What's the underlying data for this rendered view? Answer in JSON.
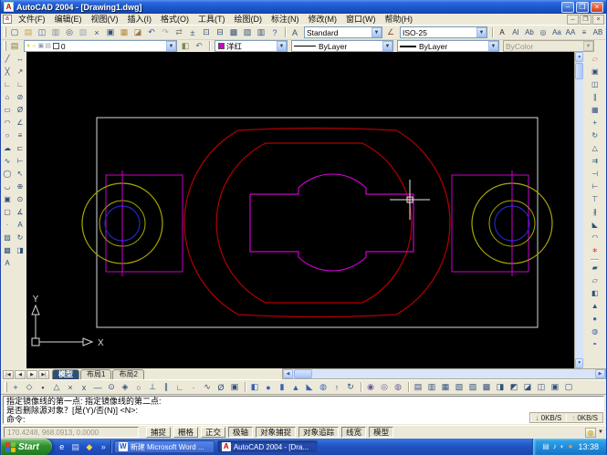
{
  "window": {
    "title": "AutoCAD 2004 - [Drawing1.dwg]"
  },
  "menu_bar": {
    "items": [
      {
        "name": "menu-file",
        "label": "文件(F)"
      },
      {
        "name": "menu-edit",
        "label": "编辑(E)"
      },
      {
        "name": "menu-view",
        "label": "视图(V)"
      },
      {
        "name": "menu-insert",
        "label": "插入(I)"
      },
      {
        "name": "menu-format",
        "label": "格式(O)"
      },
      {
        "name": "menu-tools",
        "label": "工具(T)"
      },
      {
        "name": "menu-draw",
        "label": "绘图(D)"
      },
      {
        "name": "menu-dimension",
        "label": "标注(N)"
      },
      {
        "name": "menu-modify",
        "label": "修改(M)"
      },
      {
        "name": "menu-window",
        "label": "窗口(W)"
      },
      {
        "name": "menu-help",
        "label": "帮助(H)"
      }
    ]
  },
  "standard_toolbar": [
    {
      "name": "new-file-icon",
      "glyph": "▢"
    },
    {
      "name": "open-file-icon",
      "glyph": "▤",
      "c": "#c8a24a"
    },
    {
      "name": "save-icon",
      "glyph": "◫",
      "c": "#3a62b8"
    },
    {
      "name": "plot-icon",
      "glyph": "▥",
      "c": "#7e8aa0"
    },
    {
      "name": "plot-preview-icon",
      "glyph": "◎"
    },
    {
      "name": "publish-icon",
      "glyph": "▧",
      "c": "#9aa6bc"
    },
    {
      "name": "cut-icon",
      "glyph": "×"
    },
    {
      "name": "copy-icon",
      "glyph": "▣"
    },
    {
      "name": "paste-icon",
      "glyph": "▦",
      "c": "#b08a3e"
    },
    {
      "name": "match-properties-icon",
      "glyph": "◪",
      "c": "#9a7a4e"
    },
    {
      "name": "undo-icon",
      "glyph": "↶",
      "c": "#2b58c8"
    },
    {
      "name": "redo-icon",
      "glyph": "↷",
      "c": "#9aa8c4"
    },
    {
      "name": "pan-icon",
      "glyph": "⇄",
      "c": "#8a8a8a"
    },
    {
      "name": "zoom-realtime-icon",
      "glyph": "±"
    },
    {
      "name": "zoom-window-icon",
      "glyph": "⊡"
    },
    {
      "name": "zoom-previous-icon",
      "glyph": "⊟"
    },
    {
      "name": "properties-icon",
      "glyph": "▩"
    },
    {
      "name": "designcenter-icon",
      "glyph": "▨"
    },
    {
      "name": "tool-palettes-icon",
      "glyph": "▥"
    },
    {
      "name": "help-icon",
      "glyph": "?",
      "c": "#2b58c8"
    }
  ],
  "styles_toolbar": {
    "text_style_icon": {
      "name": "text-style-icon",
      "glyph": "A"
    },
    "text_style_value": "Standard",
    "dim_style_icon": {
      "name": "dim-style-icon",
      "glyph": "∠",
      "c": "#8a4a2a"
    },
    "dim_style_value": "ISO-25"
  },
  "text_toolbar": [
    {
      "name": "mtext-icon",
      "glyph": "A",
      "c": "#202020"
    },
    {
      "name": "single-line-text-icon",
      "glyph": "AI"
    },
    {
      "name": "edit-text-icon",
      "glyph": "Ab"
    },
    {
      "name": "find-replace-icon",
      "glyph": "◎"
    },
    {
      "name": "text-style-manager-icon",
      "glyph": "Aa"
    },
    {
      "name": "scale-text-icon",
      "glyph": "AA"
    },
    {
      "name": "justify-text-icon",
      "glyph": "≡"
    },
    {
      "name": "convert-distance-icon",
      "glyph": "AB"
    }
  ],
  "layers_toolbar": {
    "manager_icon": {
      "name": "layer-properties-manager-icon",
      "glyph": "▤",
      "c": "#8a7a3e"
    },
    "bulb_icon": {
      "name": "layer-on-icon",
      "glyph": "●",
      "c": "#e8d44a"
    },
    "freeze_icon": {
      "name": "layer-freeze-icon",
      "glyph": "☼",
      "c": "#e8c81e"
    },
    "lock_icon": {
      "name": "layer-lock-icon",
      "glyph": "▣",
      "c": "#8a96b4"
    },
    "plot_icon": {
      "name": "layer-plot-icon",
      "glyph": "▤",
      "c": "#9a9a9a"
    },
    "current_layer": "0",
    "swatch_color": "#ffffff",
    "make_current_icon": {
      "name": "make-objects-layer-current-icon",
      "glyph": "◧",
      "c": "#7a8a5a"
    },
    "previous_icon": {
      "name": "layer-previous-icon",
      "glyph": "↶",
      "c": "#5a7a9e"
    }
  },
  "properties_toolbar": {
    "color_value": "洋红",
    "color_swatch": "#cc00cc",
    "linetype_value": "ByLayer",
    "lineweight_value": "ByLayer",
    "plot_style_value": "ByColor"
  },
  "draw_toolbar": [
    {
      "name": "line-icon",
      "glyph": "╱"
    },
    {
      "name": "construction-line-icon",
      "glyph": "╳"
    },
    {
      "name": "polyline-icon",
      "glyph": "∟"
    },
    {
      "name": "polygon-icon",
      "glyph": "⌂"
    },
    {
      "name": "rectangle-icon",
      "glyph": "▭"
    },
    {
      "name": "arc-icon",
      "glyph": "◠"
    },
    {
      "name": "circle-icon",
      "glyph": "○"
    },
    {
      "name": "revision-cloud-icon",
      "glyph": "☁"
    },
    {
      "name": "spline-icon",
      "glyph": "∿"
    },
    {
      "name": "ellipse-icon",
      "glyph": "◯"
    },
    {
      "name": "ellipse-arc-icon",
      "glyph": "◡"
    },
    {
      "name": "insert-block-icon",
      "glyph": "▣"
    },
    {
      "name": "make-block-icon",
      "glyph": "▢"
    },
    {
      "name": "point-icon",
      "glyph": "·"
    },
    {
      "name": "hatch-icon",
      "glyph": "▨"
    },
    {
      "name": "region-icon",
      "glyph": "▩"
    },
    {
      "name": "multiline-text-icon",
      "glyph": "A"
    }
  ],
  "dimension_toolbar": [
    {
      "name": "linear-dimension-icon",
      "glyph": "↔"
    },
    {
      "name": "aligned-dimension-icon",
      "glyph": "↗"
    },
    {
      "name": "ordinate-dimension-icon",
      "glyph": "∟"
    },
    {
      "name": "radius-dimension-icon",
      "glyph": "⊘"
    },
    {
      "name": "diameter-dimension-icon",
      "glyph": "Ø"
    },
    {
      "name": "angular-dimension-icon",
      "glyph": "∠"
    },
    {
      "name": "quick-dimension-icon",
      "glyph": "≡"
    },
    {
      "name": "baseline-dimension-icon",
      "glyph": "⊏"
    },
    {
      "name": "continue-dimension-icon",
      "glyph": "⊢"
    },
    {
      "name": "quick-leader-icon",
      "glyph": "↖"
    },
    {
      "name": "tolerance-icon",
      "glyph": "⊕"
    },
    {
      "name": "center-mark-icon",
      "glyph": "⊙"
    },
    {
      "name": "dimension-edit-icon",
      "glyph": "∡"
    },
    {
      "name": "dimension-text-edit-icon",
      "glyph": "A"
    },
    {
      "name": "dimension-update-icon",
      "glyph": "↻"
    },
    {
      "name": "dimension-style-icon",
      "glyph": "◨"
    }
  ],
  "modify_toolbar": [
    {
      "name": "erase-icon",
      "glyph": "▱",
      "c": "#c87a7a"
    },
    {
      "name": "copy-object-icon",
      "glyph": "▣"
    },
    {
      "name": "mirror-icon",
      "glyph": "◫"
    },
    {
      "name": "offset-icon",
      "glyph": "∥"
    },
    {
      "name": "array-icon",
      "glyph": "▦"
    },
    {
      "name": "move-icon",
      "glyph": "+"
    },
    {
      "name": "rotate-icon",
      "glyph": "↻"
    },
    {
      "name": "scale-icon",
      "glyph": "△"
    },
    {
      "name": "stretch-icon",
      "glyph": "⇉"
    },
    {
      "name": "trim-icon",
      "glyph": "⊣"
    },
    {
      "name": "extend-icon",
      "glyph": "⊢"
    },
    {
      "name": "break-at-point-icon",
      "glyph": "⊤"
    },
    {
      "name": "break-icon",
      "glyph": "∦"
    },
    {
      "name": "chamfer-icon",
      "glyph": "◣"
    },
    {
      "name": "fillet-icon",
      "glyph": "◠"
    },
    {
      "name": "explode-icon",
      "glyph": "∗",
      "c": "#c8503c"
    }
  ],
  "surfaces_toolbar": [
    {
      "name": "surface-2dsolid-icon",
      "glyph": "▰"
    },
    {
      "name": "surface-3dface-icon",
      "glyph": "▱"
    },
    {
      "name": "surface-box-icon",
      "glyph": "◧"
    },
    {
      "name": "surface-pyramid-icon",
      "glyph": "▲"
    },
    {
      "name": "render-sphere-icon",
      "glyph": "●",
      "c": "#3a62b8"
    },
    {
      "name": "render-torus-icon",
      "glyph": "◍",
      "c": "#3a62b8"
    },
    {
      "name": "render-dome-icon",
      "glyph": "◓",
      "c": "#3a62b8"
    }
  ],
  "osnap_toolbar": [
    {
      "name": "temporary-track-point-icon",
      "glyph": "+"
    },
    {
      "name": "snap-from-icon",
      "glyph": "◇"
    },
    {
      "name": "snap-endpoint-icon",
      "glyph": "▪"
    },
    {
      "name": "snap-midpoint-icon",
      "glyph": "△"
    },
    {
      "name": "snap-intersection-icon",
      "glyph": "×"
    },
    {
      "name": "snap-apparent-intersection-icon",
      "glyph": "x"
    },
    {
      "name": "snap-extension-icon",
      "glyph": "—"
    },
    {
      "name": "snap-center-icon",
      "glyph": "⊙"
    },
    {
      "name": "snap-quadrant-icon",
      "glyph": "◈"
    },
    {
      "name": "snap-tangent-icon",
      "glyph": "○"
    },
    {
      "name": "snap-perpendicular-icon",
      "glyph": "⊥"
    },
    {
      "name": "snap-parallel-icon",
      "glyph": "∥"
    },
    {
      "name": "snap-insert-icon",
      "glyph": "∟"
    },
    {
      "name": "snap-node-icon",
      "glyph": "·"
    },
    {
      "name": "snap-nearest-icon",
      "glyph": "∿"
    },
    {
      "name": "snap-none-icon",
      "glyph": "Ø"
    },
    {
      "name": "osnap-settings-icon",
      "glyph": "▣"
    }
  ],
  "solids_toolbar": [
    {
      "name": "solids-box-icon",
      "glyph": "◧",
      "c": "#3a62b8"
    },
    {
      "name": "solids-sphere-icon",
      "glyph": "●",
      "c": "#3a62b8"
    },
    {
      "name": "solids-cylinder-icon",
      "glyph": "▮",
      "c": "#3a62b8"
    },
    {
      "name": "solids-cone-icon",
      "glyph": "▲",
      "c": "#3a62b8"
    },
    {
      "name": "solids-wedge-icon",
      "glyph": "◣",
      "c": "#3a62b8"
    },
    {
      "name": "solids-torus-icon",
      "glyph": "◍",
      "c": "#3a62b8"
    },
    {
      "name": "solids-extrude-icon",
      "glyph": "↑"
    },
    {
      "name": "solids-revolve-icon",
      "glyph": "↻"
    }
  ],
  "boolean_toolbar": [
    {
      "name": "union-icon",
      "glyph": "◉",
      "c": "#6a5a9e"
    },
    {
      "name": "subtract-icon",
      "glyph": "◎",
      "c": "#6a5a9e"
    },
    {
      "name": "intersect-icon",
      "glyph": "◍",
      "c": "#6a5a9e"
    }
  ],
  "solidedit_toolbar": [
    {
      "name": "extrude-faces-icon",
      "glyph": "▤"
    },
    {
      "name": "move-faces-icon",
      "glyph": "▥"
    },
    {
      "name": "offset-faces-icon",
      "glyph": "▦"
    },
    {
      "name": "delete-faces-icon",
      "glyph": "▧"
    },
    {
      "name": "rotate-faces-icon",
      "glyph": "▨"
    },
    {
      "name": "taper-faces-icon",
      "glyph": "▩"
    },
    {
      "name": "copy-faces-icon",
      "glyph": "◨"
    },
    {
      "name": "color-faces-icon",
      "glyph": "◩"
    },
    {
      "name": "copy-edges-icon",
      "glyph": "◪"
    },
    {
      "name": "color-edges-icon",
      "glyph": "◫"
    },
    {
      "name": "imprint-icon",
      "glyph": "▣"
    },
    {
      "name": "clean-icon",
      "glyph": "▢"
    }
  ],
  "canvas": {
    "ucs": {
      "x_label": "X",
      "y_label": "Y"
    },
    "colors": {
      "background": "#000000",
      "white": "#d9d9d9",
      "red": "#b40000",
      "magenta": "#cc00cc",
      "yellow": "#a8a800",
      "blue": "#2424c8",
      "crosshair": "#e8e8e8"
    }
  },
  "layout_tabs": {
    "nav": [
      {
        "name": "tab-nav-first",
        "glyph": "|◀"
      },
      {
        "name": "tab-nav-prev",
        "glyph": "◀"
      },
      {
        "name": "tab-nav-next",
        "glyph": "▶"
      },
      {
        "name": "tab-nav-last",
        "glyph": "▶|"
      }
    ],
    "tabs": [
      {
        "name": "tab-model",
        "label": "模型",
        "active": true
      },
      {
        "name": "tab-layout1",
        "label": "布局1"
      },
      {
        "name": "tab-layout2",
        "label": "布局2"
      }
    ]
  },
  "command_line": {
    "history_line1": "指定镜像线的第一点: 指定镜像线的第二点:",
    "history_line2": "是否删除源对象？[是(Y)/否(N)] <N>:",
    "prompt": "命令:"
  },
  "net_monitor": {
    "down_arrow": "↓",
    "down_label": "0KB/S",
    "up_arrow": "↑",
    "up_label": "0KB/S"
  },
  "status_bar": {
    "coordinates": "170.4248, 968.0913, 0.0000",
    "toggles": [
      {
        "name": "toggle-snap",
        "label": "捕捉",
        "active": false
      },
      {
        "name": "toggle-grid",
        "label": "栅格",
        "active": false
      },
      {
        "name": "toggle-ortho",
        "label": "正交",
        "active": false
      },
      {
        "name": "toggle-polar",
        "label": "极轴",
        "active": true
      },
      {
        "name": "toggle-osnap",
        "label": "对象捕捉",
        "active": true
      },
      {
        "name": "toggle-otrack",
        "label": "对象追踪",
        "active": true
      },
      {
        "name": "toggle-lineweight",
        "label": "线宽",
        "active": true
      },
      {
        "name": "toggle-model",
        "label": "模型",
        "active": true
      }
    ]
  },
  "taskbar": {
    "start_label": "Start",
    "quick_launch": [
      {
        "name": "quick-launch-ie-icon",
        "glyph": "e",
        "c": "#ffffff"
      },
      {
        "name": "quick-launch-show-desktop-icon",
        "glyph": "▤",
        "c": "#cfe0ff"
      },
      {
        "name": "quick-launch-media-icon",
        "glyph": "◆",
        "c": "#ffd24a"
      }
    ],
    "overflow": "»",
    "tasks": [
      {
        "label": "新建 Microsoft Word ...",
        "icon": "W"
      },
      {
        "label": "AutoCAD 2004 - [Dra...",
        "icon": "A"
      }
    ],
    "tray_icons": [
      {
        "name": "tray-input-method-icon",
        "glyph": "▤",
        "c": "#e8e8e8"
      },
      {
        "name": "tray-volume-icon",
        "glyph": "♪",
        "c": "#ffffff"
      },
      {
        "name": "tray-network-icon",
        "glyph": "◐",
        "c": "#cfe0ff"
      },
      {
        "name": "tray-antivirus-icon",
        "glyph": "●",
        "c": "#ff9a2a"
      }
    ],
    "clock": "13:38"
  }
}
